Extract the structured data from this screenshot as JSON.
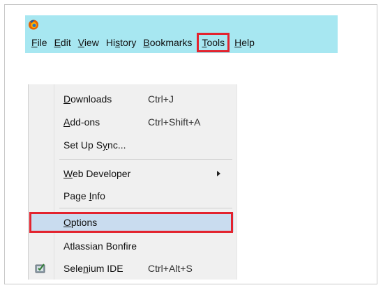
{
  "browser": {
    "logo_icon": "firefox-icon",
    "menubar": [
      {
        "id": "file",
        "pre": "",
        "ul": "F",
        "post": "ile"
      },
      {
        "id": "edit",
        "pre": "",
        "ul": "E",
        "post": "dit"
      },
      {
        "id": "view",
        "pre": "",
        "ul": "V",
        "post": "iew"
      },
      {
        "id": "history",
        "pre": "Hi",
        "ul": "s",
        "post": "tory"
      },
      {
        "id": "bookmarks",
        "pre": "",
        "ul": "B",
        "post": "ookmarks"
      },
      {
        "id": "tools",
        "pre": "",
        "ul": "T",
        "post": "ools"
      },
      {
        "id": "help",
        "pre": "",
        "ul": "H",
        "post": "elp"
      }
    ],
    "highlighted_menu": "tools",
    "highlight_color": "#e3232e",
    "menubar_color": "#a7e7f1"
  },
  "tools_menu": {
    "items": [
      {
        "id": "downloads",
        "pre": "",
        "ul": "D",
        "post": "ownloads",
        "shortcut": "Ctrl+J"
      },
      {
        "id": "addons",
        "pre": "",
        "ul": "A",
        "post": "dd-ons",
        "shortcut": "Ctrl+Shift+A"
      },
      {
        "id": "setup-sync",
        "pre": "Set Up S",
        "ul": "y",
        "post": "nc...",
        "shortcut": ""
      },
      {
        "id": "web-developer",
        "pre": "",
        "ul": "W",
        "post": "eb Developer",
        "shortcut": "",
        "submenu": true
      },
      {
        "id": "page-info",
        "pre": "Page ",
        "ul": "I",
        "post": "nfo",
        "shortcut": ""
      },
      {
        "id": "options",
        "pre": "",
        "ul": "O",
        "post": "ptions",
        "shortcut": "",
        "selected": true
      },
      {
        "id": "atlassian-bonfire",
        "pre": "Atlassian Bonfire",
        "ul": "",
        "post": "",
        "shortcut": ""
      },
      {
        "id": "selenium-ide",
        "pre": "Sele",
        "ul": "n",
        "post": "ium IDE",
        "shortcut": "Ctrl+Alt+S",
        "icon": "selenium-icon"
      }
    ],
    "selected_color": "#c9dcef"
  }
}
